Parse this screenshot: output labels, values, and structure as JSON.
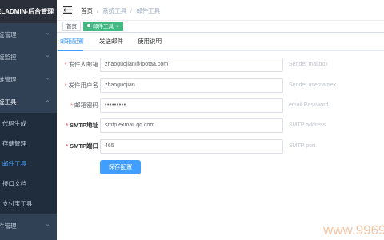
{
  "sidebar": {
    "brand": "ELADMIN-后台管理",
    "menus": [
      {
        "label": "统管理"
      },
      {
        "label": "统监控"
      },
      {
        "label": "维管理"
      },
      {
        "label": "统工具"
      },
      {
        "label": "件管理"
      }
    ],
    "submenu": [
      {
        "label": "代码生成"
      },
      {
        "label": "存储管理"
      },
      {
        "label": "邮件工具"
      },
      {
        "label": "接口文档"
      },
      {
        "label": "支付宝工具"
      }
    ]
  },
  "navbar": {
    "breadcrumb": [
      "首页",
      "系统工具",
      "邮件工具"
    ]
  },
  "tags": {
    "home": "首页",
    "active": "邮件工具",
    "close_glyph": "×"
  },
  "tabs": [
    "邮箱配置",
    "发送邮件",
    "使用说明"
  ],
  "form": {
    "fields": [
      {
        "label": "发件人邮箱",
        "value": "zhaoguojian@lootaa.com",
        "hint": "Sender mailbox"
      },
      {
        "label": "发件用户名",
        "value": "zhaoguojian",
        "hint": "Sender usernamex"
      },
      {
        "label": "邮箱密码",
        "value": "•••••••••",
        "hint": "email Password"
      },
      {
        "label": "SMTP地址",
        "value": "smtp.exmail.qq.com",
        "hint": "SMTP address"
      },
      {
        "label": "SMTP端口",
        "value": "465",
        "hint": "SMTP port"
      }
    ],
    "save_label": "保存配置"
  },
  "watermark": "www.9969",
  "colors": {
    "sidebar_bg": "#304156",
    "accent": "#409eff",
    "tag_active": "#42b983"
  }
}
